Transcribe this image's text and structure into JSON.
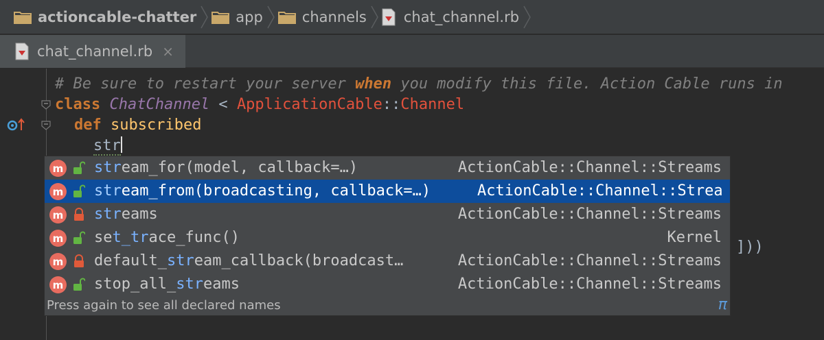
{
  "breadcrumb": {
    "items": [
      {
        "label": "actioncable-chatter",
        "icon": "folder-icon"
      },
      {
        "label": "app",
        "icon": "folder-icon"
      },
      {
        "label": "channels",
        "icon": "folder-icon"
      },
      {
        "label": "chat_channel.rb",
        "icon": "ruby-file-icon"
      }
    ]
  },
  "tabs": [
    {
      "label": "chat_channel.rb",
      "close": "×"
    }
  ],
  "editor": {
    "comment_pre": "# Be sure to restart your server ",
    "comment_kw": "when",
    "comment_post": " you modify this file. Action Cable runs in",
    "line2": {
      "kw": "class",
      "name": "ChatChannel",
      "op": " < ",
      "base": "ApplicationCable",
      "sep": "::",
      "base2": "Channel"
    },
    "line3": {
      "kw": "def",
      "name": "subscribed"
    },
    "typed": "str",
    "trailing": "]))"
  },
  "completion": {
    "items": [
      {
        "pre": "",
        "hl": "str",
        "post": "eam_for(model, callback=…)",
        "type": "ActionCable::Channel::Streams",
        "lock": "open"
      },
      {
        "pre": "",
        "hl": "str",
        "post": "eam_from(broadcasting, callback=…)",
        "type": "ActionCable::Channel::Strea",
        "lock": "open",
        "selected": true
      },
      {
        "pre": "",
        "hl": "str",
        "post": "eams",
        "type": "ActionCable::Channel::Streams",
        "lock": "closed"
      },
      {
        "pre": "se",
        "hl": "t_tr",
        "post": "ace_func()",
        "type": "Kernel",
        "lock": "open"
      },
      {
        "pre": "default_",
        "hl": "str",
        "post": "eam_callback(broadcast…",
        "type": "ActionCable::Channel::Streams",
        "lock": "closed"
      },
      {
        "pre": "stop_all_",
        "hl": "str",
        "post": "eams",
        "type": "ActionCable::Channel::Streams",
        "lock": "open"
      }
    ],
    "badge": "m",
    "hint": "Press again to see all declared names",
    "pi": "π"
  },
  "colors": {
    "background": "#2b2b2b",
    "selection": "#0d4d9c",
    "keyword": "#cc7832",
    "class": "#9876aa",
    "method": "#ffc66d"
  }
}
